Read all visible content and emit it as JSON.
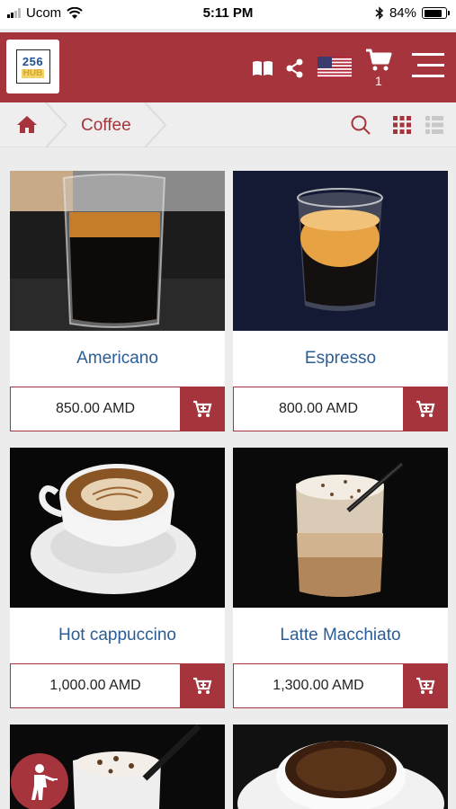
{
  "status_bar": {
    "carrier": "Ucom",
    "time": "5:11 PM",
    "battery": "84%",
    "battery_level": 0.84
  },
  "header": {
    "logo_top": "256",
    "logo_bottom": "HUB",
    "cart_count": "1",
    "icons": [
      "book-icon",
      "share-icon",
      "us-flag-icon",
      "cart-icon",
      "menu-icon"
    ]
  },
  "breadcrumb": {
    "category": "Coffee"
  },
  "products": [
    {
      "name": "Americano",
      "price": "850.00 AMD"
    },
    {
      "name": "Espresso",
      "price": "800.00 AMD"
    },
    {
      "name": "Hot cappuccino",
      "price": "1,000.00 AMD"
    },
    {
      "name": "Latte Macchiato",
      "price": "1,300.00 AMD"
    }
  ],
  "colors": {
    "brand": "#a5343c",
    "link": "#2a5d97"
  }
}
